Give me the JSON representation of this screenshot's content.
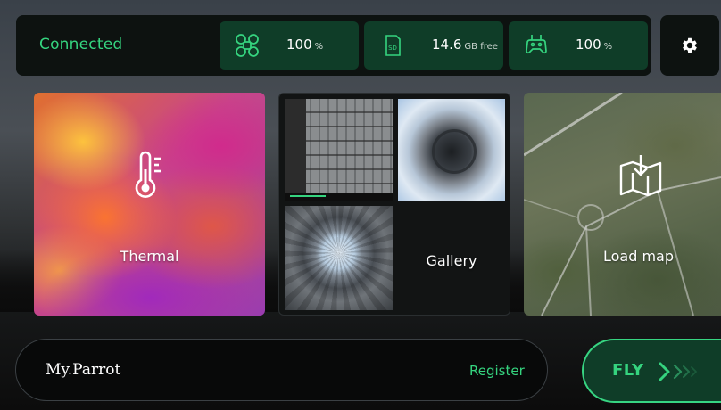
{
  "status": {
    "connection": "Connected",
    "drone_battery": {
      "value": "100",
      "unit": "%",
      "icon": "drone-icon"
    },
    "storage": {
      "value": "14.6",
      "unit": "GB free",
      "icon": "sd-card-icon",
      "icon_text": "SD"
    },
    "controller_battery": {
      "value": "100",
      "unit": "%",
      "icon": "controller-icon"
    },
    "settings_icon": "gear-icon"
  },
  "tiles": {
    "thermal": {
      "label": "Thermal",
      "icon": "thermometer-icon"
    },
    "gallery": {
      "label": "Gallery"
    },
    "map": {
      "label": "Load map",
      "icon": "map-download-icon"
    }
  },
  "bottom": {
    "brand": "My.Parrot",
    "register": "Register",
    "fly": "FLY"
  },
  "colors": {
    "accent_green": "#35d47f",
    "pill_bg": "#0f3d28",
    "bar_bg": "#0d1210"
  }
}
